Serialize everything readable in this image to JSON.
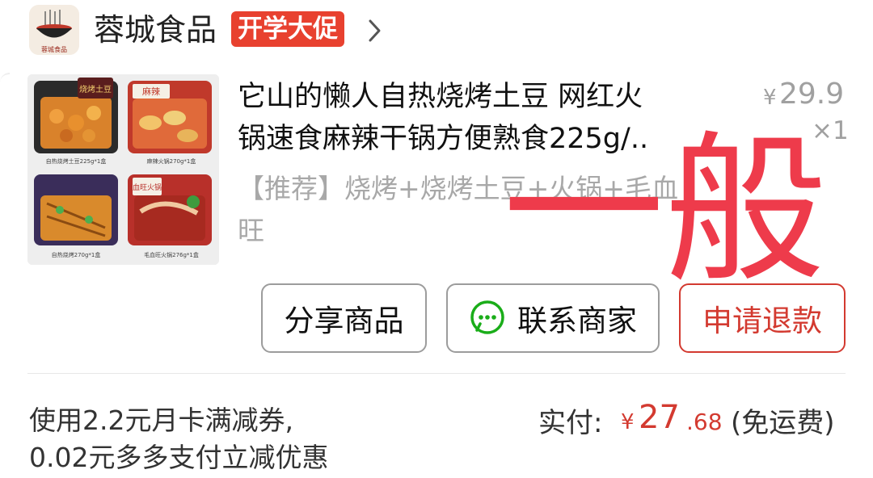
{
  "store": {
    "logo_text": "蓉城食品",
    "name": "蓉城食品",
    "badge": "开学大促"
  },
  "product": {
    "title": "它山的懒人自热烧烤土豆 网红火\n锅速食麻辣干锅方便熟食225g/..",
    "spec": "【推荐】烧烤+烧烤土豆+火锅+毛血\n旺",
    "price_symbol": "¥",
    "price": "29.9",
    "quantity": "×1",
    "thumbnail_labels": [
      "自热烧烤土豆225g*1盒",
      "麻辣火锅270g*1盒",
      "自热烧烤270g*1盒",
      "毛血旺火锅276g*1盒"
    ],
    "thumbnail_titles": [
      "烧烤土豆",
      "麻辣",
      "血旺火锅"
    ]
  },
  "overlay": {
    "text": "一般",
    "color": "#ee3b4b"
  },
  "actions": {
    "share": "分享商品",
    "contact": "联系商家",
    "refund": "申请退款"
  },
  "footer": {
    "coupon_line1": "使用2.2元月卡满减券,",
    "coupon_line2": "0.02元多多支付立减优惠",
    "paid_label": "实付:",
    "paid_symbol": "¥",
    "paid_int": "27",
    "paid_dec": ".68",
    "shipping": "(免运费)"
  },
  "colors": {
    "accent_red": "#d33a30",
    "badge_red": "#e8412f",
    "muted": "#a0a0a0"
  }
}
